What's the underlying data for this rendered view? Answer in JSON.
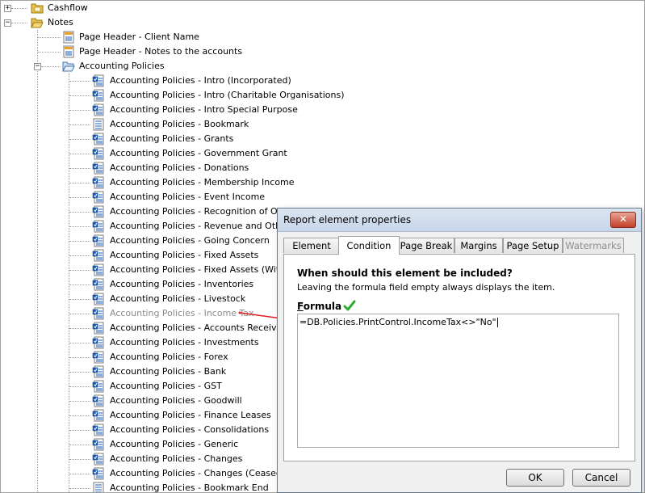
{
  "tree": {
    "top_items": [
      {
        "label": "Cashflow",
        "expander": "+",
        "icon": "folder-icon"
      },
      {
        "label": "Notes",
        "expander": "−",
        "icon": "folder-open-icon"
      }
    ],
    "notes_children": [
      {
        "label": "Page Header - Client Name",
        "icon": "page-header-icon"
      },
      {
        "label": "Page Header - Notes to the accounts",
        "icon": "page-header-icon"
      },
      {
        "label": "Accounting Policies",
        "icon": "folder-open-icon",
        "expander": "−"
      }
    ],
    "policies": [
      {
        "label": "Accounting Policies - Intro (Incorporated)",
        "icon": "element-icon"
      },
      {
        "label": "Accounting Policies - Intro (Charitable Organisations)",
        "icon": "element-icon"
      },
      {
        "label": "Accounting Policies - Intro Special Purpose",
        "icon": "element-icon"
      },
      {
        "label": "Accounting Policies - Bookmark",
        "icon": "bookmark-icon"
      },
      {
        "label": "Accounting Policies - Grants",
        "icon": "element-icon"
      },
      {
        "label": "Accounting Policies - Government Grant",
        "icon": "element-icon"
      },
      {
        "label": "Accounting Policies - Donations",
        "icon": "element-icon"
      },
      {
        "label": "Accounting Policies - Membership Income",
        "icon": "element-icon"
      },
      {
        "label": "Accounting Policies - Event Income",
        "icon": "element-icon"
      },
      {
        "label": "Accounting Policies - Recognition of Other R",
        "icon": "element-icon"
      },
      {
        "label": "Accounting Policies - Revenue and Other In",
        "icon": "element-icon"
      },
      {
        "label": "Accounting Policies - Going Concern",
        "icon": "element-icon"
      },
      {
        "label": "Accounting Policies - Fixed Assets",
        "icon": "element-icon"
      },
      {
        "label": "Accounting Policies - Fixed Assets (With Rat",
        "icon": "element-icon"
      },
      {
        "label": "Accounting Policies - Inventories",
        "icon": "element-icon"
      },
      {
        "label": "Accounting Policies - Livestock",
        "icon": "element-icon"
      },
      {
        "label": "Accounting Policies - Income Tax",
        "icon": "element-icon",
        "dim": true
      },
      {
        "label": "Accounting Policies - Accounts Receivable",
        "icon": "element-icon"
      },
      {
        "label": "Accounting Policies - Investments",
        "icon": "element-icon"
      },
      {
        "label": "Accounting Policies - Forex",
        "icon": "element-icon"
      },
      {
        "label": "Accounting Policies - Bank",
        "icon": "element-icon"
      },
      {
        "label": "Accounting Policies - GST",
        "icon": "element-icon"
      },
      {
        "label": "Accounting Policies - Goodwill",
        "icon": "element-icon"
      },
      {
        "label": "Accounting Policies - Finance Leases",
        "icon": "element-icon"
      },
      {
        "label": "Accounting Policies - Consolidations",
        "icon": "element-icon"
      },
      {
        "label": "Accounting Policies - Generic",
        "icon": "element-icon"
      },
      {
        "label": "Accounting Policies - Changes",
        "icon": "element-icon"
      },
      {
        "label": "Accounting Policies - Changes (Ceased)",
        "icon": "element-icon"
      },
      {
        "label": "Accounting Policies - Bookmark End",
        "icon": "bookmark-icon"
      }
    ]
  },
  "dialog": {
    "title": "Report element properties",
    "close_label": "✕",
    "tabs": [
      {
        "label": "Element"
      },
      {
        "label": "Condition",
        "active": true
      },
      {
        "label": "Page Break"
      },
      {
        "label": "Margins"
      },
      {
        "label": "Page Setup"
      },
      {
        "label": "Watermarks",
        "disabled": true
      }
    ],
    "question": "When should this element be included?",
    "hint": "Leaving the formula field empty always displays the item.",
    "formula_label_first": "F",
    "formula_label_rest": "ormula",
    "formula_value": "=DB.Policies.PrintControl.IncomeTax<>\"No\"",
    "ok_label": "OK",
    "cancel_label": "Cancel"
  },
  "colors": {
    "arrow": "#e02020",
    "check": "#2fa82f",
    "folder": "#e8c04a",
    "element_icon": "#1d5fb8"
  }
}
